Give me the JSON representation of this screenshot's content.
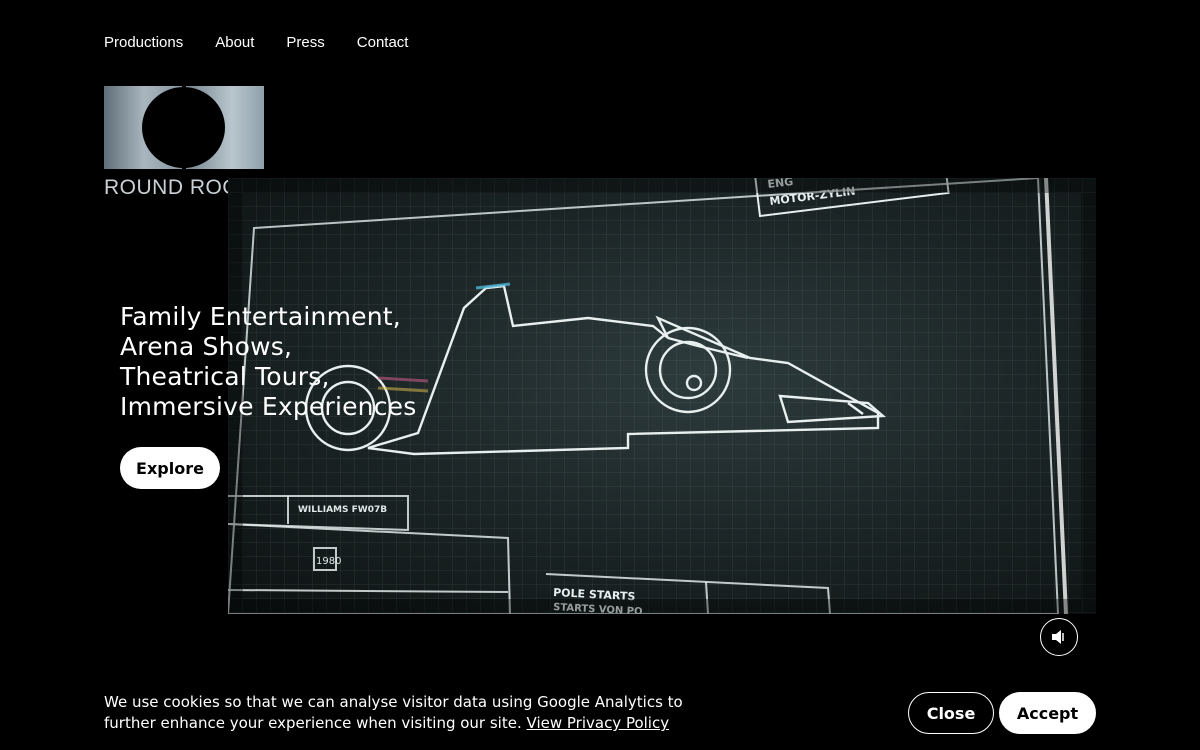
{
  "nav": {
    "items": [
      {
        "label": "Productions"
      },
      {
        "label": "About"
      },
      {
        "label": "Press"
      },
      {
        "label": "Contact"
      }
    ]
  },
  "logo": {
    "wordmark": "ROUND ROOM"
  },
  "hero": {
    "tagline": [
      "Family Entertainment,",
      "Arena Shows,",
      "Theatrical Tours,",
      "Immersive Experiences"
    ],
    "explore_label": "Explore",
    "mute_icon": "speaker-muted-icon"
  },
  "video_frame": {
    "labels": {
      "engine": "ENG",
      "motor": "MOTOR-ZYLIN",
      "williams": "WILLIAMS FW07B",
      "year": "1980",
      "pole1": "POLE STARTS",
      "pole2": "STARTS VON PO"
    }
  },
  "cookie": {
    "text": "We use cookies so that we can analyse visitor data using Google Analytics to further enhance your experience when visiting our site.",
    "policy_link": "View Privacy Policy",
    "close_label": "Close",
    "accept_label": "Accept"
  },
  "colors": {
    "background": "#000000",
    "text": "#ffffff",
    "blueprint_line": "#d8e2e2"
  }
}
